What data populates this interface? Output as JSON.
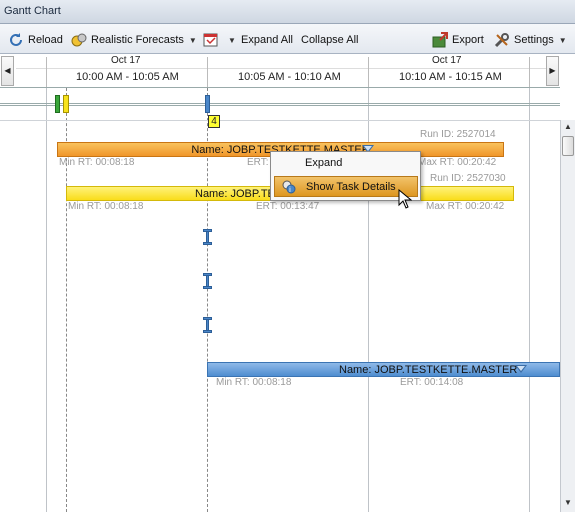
{
  "window": {
    "title": "Gantt Chart"
  },
  "toolbar": {
    "reload": "Reload",
    "forecasts": "Realistic Forecasts",
    "expand_all": "Expand All",
    "collapse_all": "Collapse All",
    "export": "Export",
    "settings": "Settings"
  },
  "timeline": {
    "dates": [
      "Oct 17",
      "Oct 17"
    ],
    "slots": [
      "10:00 AM - 10:05 AM",
      "10:05 AM - 10:10 AM",
      "10:10 AM - 10:15 AM"
    ]
  },
  "overview_marker": "4",
  "tasks": [
    {
      "name": "Name: JOBP.TESTKETTE.MASTER",
      "run_id": "Run ID: 2527014",
      "min_rt": "Min RT: 00:08:18",
      "ert": "ERT:",
      "max_rt": "Max RT: 00:20:42"
    },
    {
      "name": "Name: JOBP.TE",
      "run_id": "Run ID: 2527030",
      "min_rt": "Min RT: 00:08:18",
      "ert": "ERT: 00:13:47",
      "max_rt": "Max RT: 00:20:42"
    },
    {
      "name": "Name: JOBP.TESTKETTE.MASTER",
      "min_rt": "Min RT: 00:08:18",
      "ert": "ERT: 00:14:08"
    }
  ],
  "context_menu": {
    "expand": "Expand",
    "show_details": "Show Task Details"
  },
  "colors": {
    "orange_bar": "#f0962a",
    "yellow_bar": "#f9dd1a",
    "blue_bar": "#4f8dd0",
    "menu_highlight": "#dd9620"
  }
}
